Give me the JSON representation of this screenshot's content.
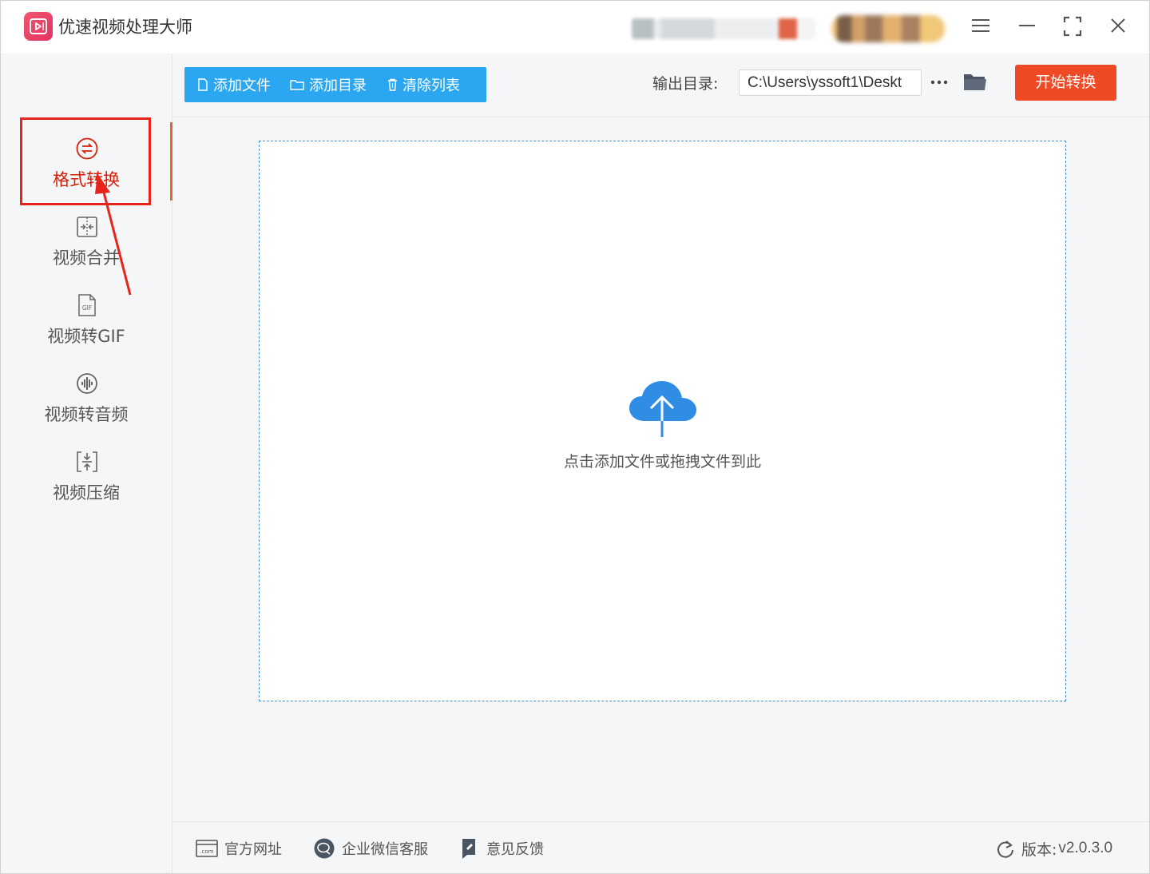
{
  "app": {
    "title": "优速视频处理大师"
  },
  "window_controls": {
    "menu_icon": "hamburger-menu-icon",
    "minimize_icon": "minimize-icon",
    "maximize_icon": "maximize-icon",
    "close_icon": "close-icon"
  },
  "sidebar": {
    "items": [
      {
        "label": "格式转换",
        "icon": "format-convert-icon",
        "active": true
      },
      {
        "label": "视频合并",
        "icon": "merge-icon",
        "active": false
      },
      {
        "label": "视频转GIF",
        "icon": "gif-file-icon",
        "active": false
      },
      {
        "label": "视频转音频",
        "icon": "audio-icon",
        "active": false
      },
      {
        "label": "视频压缩",
        "icon": "compress-icon",
        "active": false
      }
    ]
  },
  "toolbar": {
    "add_file": "添加文件",
    "add_dir": "添加目录",
    "clear_list": "清除列表",
    "output_label": "输出目录:",
    "output_path": "C:\\Users\\yssoft1\\Deskt",
    "more_label": "···",
    "start": "开始转换"
  },
  "dropzone": {
    "text": "点击添加文件或拖拽文件到此",
    "icon": "cloud-upload-icon"
  },
  "footer": {
    "website": "官方网址",
    "wechat": "企业微信客服",
    "feedback": "意见反馈",
    "version_label": "版本:",
    "version_value": "v2.0.3.0"
  },
  "colors": {
    "accent_blue": "#2ba6f0",
    "start_red": "#ee4a26",
    "active_red": "#d81e06",
    "annotation_red": "#e8231b"
  }
}
